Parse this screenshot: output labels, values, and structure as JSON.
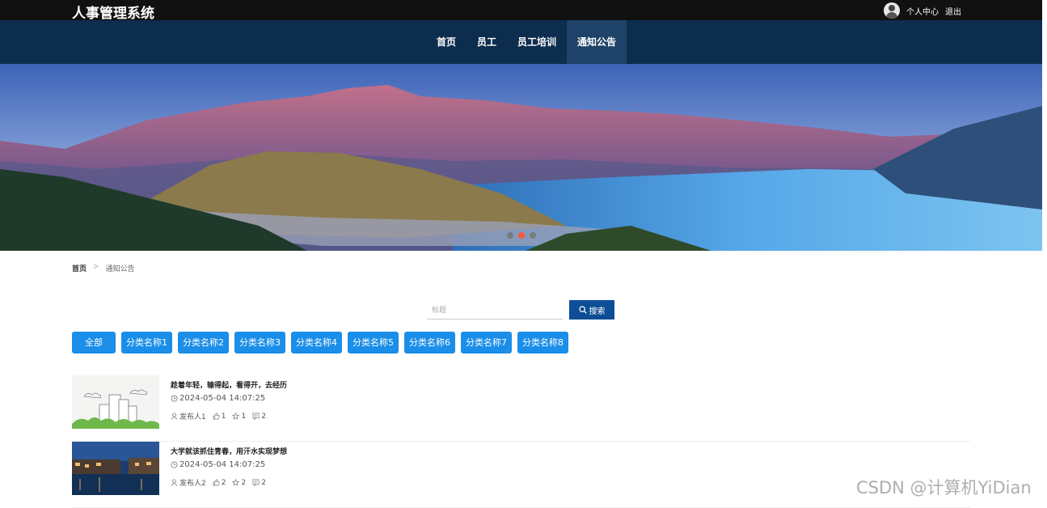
{
  "header": {
    "app_title": "人事管理系统",
    "personal_center": "个人中心",
    "logout": "退出"
  },
  "nav": {
    "items": [
      {
        "label": "首页"
      },
      {
        "label": "员工"
      },
      {
        "label": "员工培训"
      },
      {
        "label": "通知公告"
      }
    ],
    "active_index": 3
  },
  "banner": {
    "dots": 3,
    "active_dot": 1
  },
  "breadcrumb": {
    "home": "首页",
    "separator": ">",
    "current": "通知公告"
  },
  "search": {
    "placeholder": "标题",
    "value": "",
    "button_label": "搜索"
  },
  "categories": [
    {
      "label": "全部"
    },
    {
      "label": "分类名称1"
    },
    {
      "label": "分类名称2"
    },
    {
      "label": "分类名称3"
    },
    {
      "label": "分类名称4"
    },
    {
      "label": "分类名称5"
    },
    {
      "label": "分类名称6"
    },
    {
      "label": "分类名称7"
    },
    {
      "label": "分类名称8"
    }
  ],
  "notices": [
    {
      "title": "趁着年轻，输得起，看得开，去经历",
      "time": "2024-05-04 14:07:25",
      "publisher": "发布人1",
      "likes": "1",
      "favorites": "1",
      "comments": "2"
    },
    {
      "title": "大学就该抓住青春，用汗水实现梦想",
      "time": "2024-05-04 14:07:25",
      "publisher": "发布人2",
      "likes": "2",
      "favorites": "2",
      "comments": "2"
    }
  ],
  "watermark": "CSDN @计算机YiDian",
  "colors": {
    "topbar": "#111111",
    "navbar": "#0d2d4e",
    "nav_active": "#1e4268",
    "category_button": "#1a8ee8",
    "search_button": "#0d4e96",
    "active_dot": "#f55a3c"
  }
}
